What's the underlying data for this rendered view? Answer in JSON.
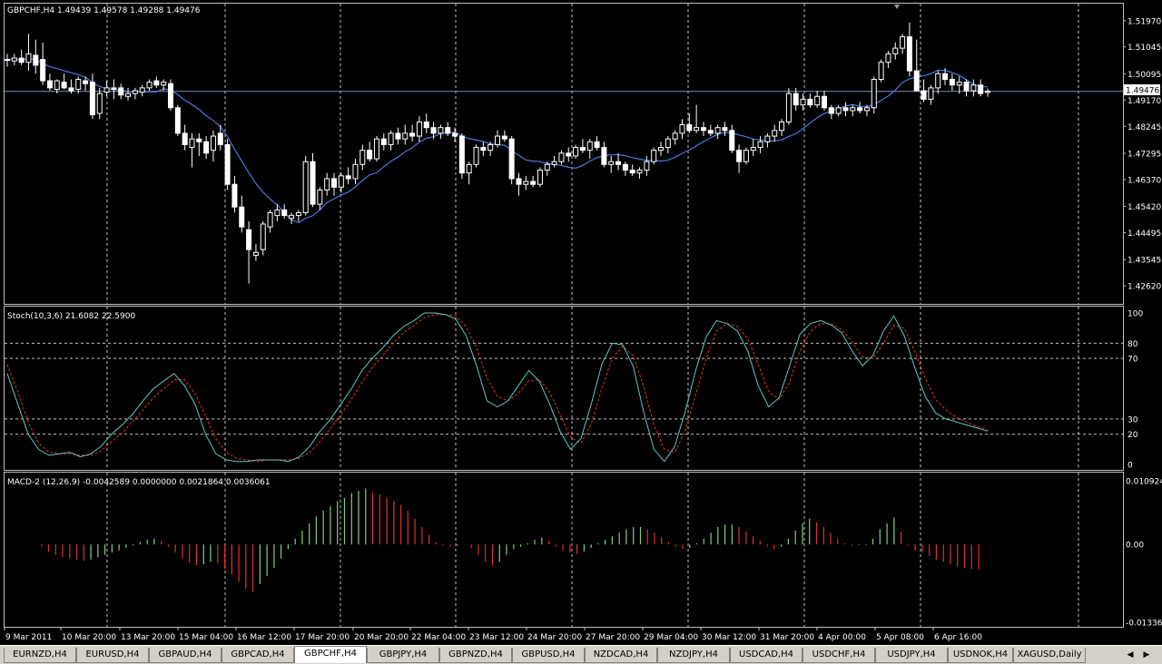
{
  "main_chart": {
    "header": "GBPCHF,H4  1.49439 1.49578 1.49288 1.49476",
    "price_min": 1.4205,
    "price_max": 1.5225,
    "price_labels": [
      "1.51970",
      "1.51045",
      "1.50095",
      "1.49170",
      "1.48245",
      "1.47295",
      "1.46370",
      "1.45420",
      "1.44495",
      "1.43545",
      "1.42620"
    ],
    "current_price_label": "1.49476",
    "current_price": 1.49476,
    "colors": {
      "bull": "#ffffff",
      "bear": "#ffffff",
      "ma": "#4a78e0",
      "current_line": "#7a8fbf",
      "grid": "#c0c0c0",
      "axis_text": "#ffffff"
    }
  },
  "stoch": {
    "header": "Stoch(10,3,6) 21.6082 22.5900",
    "labels": [
      "100",
      "80",
      "70",
      "30",
      "20",
      "0"
    ],
    "level_values": [
      80,
      70,
      30,
      20
    ],
    "main_color": "#5fc9c0",
    "signal_color": "#e03030",
    "main": [
      60,
      40,
      20,
      10,
      6,
      7,
      8,
      5,
      7,
      12,
      20,
      26,
      33,
      42,
      50,
      55,
      60,
      52,
      40,
      20,
      7,
      3,
      2,
      2,
      3,
      3,
      3,
      2,
      5,
      12,
      22,
      30,
      40,
      50,
      62,
      70,
      77,
      85,
      91,
      95,
      100,
      100,
      99,
      96,
      85,
      65,
      42,
      38,
      42,
      52,
      62,
      55,
      40,
      22,
      10,
      17,
      40,
      66,
      80,
      79,
      65,
      35,
      10,
      2,
      12,
      35,
      62,
      84,
      95,
      93,
      88,
      75,
      52,
      38,
      44,
      65,
      86,
      93,
      95,
      92,
      87,
      75,
      65,
      72,
      88,
      98,
      85,
      64,
      45,
      34,
      30,
      28,
      26,
      24,
      22
    ],
    "signal": [
      66,
      48,
      28,
      14,
      8,
      7,
      7,
      6,
      6,
      9,
      15,
      21,
      28,
      36,
      44,
      50,
      56,
      56,
      47,
      32,
      17,
      8,
      4,
      3,
      2,
      3,
      3,
      3,
      4,
      8,
      15,
      24,
      33,
      43,
      54,
      64,
      72,
      80,
      87,
      92,
      97,
      99,
      99,
      98,
      91,
      77,
      57,
      45,
      42,
      47,
      55,
      56,
      48,
      33,
      18,
      14,
      27,
      50,
      70,
      78,
      72,
      52,
      26,
      10,
      8,
      22,
      46,
      70,
      88,
      93,
      91,
      83,
      66,
      48,
      43,
      54,
      75,
      88,
      93,
      93,
      89,
      81,
      71,
      70,
      80,
      92,
      90,
      75,
      57,
      43,
      36,
      31,
      28,
      25,
      23
    ]
  },
  "macd": {
    "header": "MACD-2 (12,26,9) -0.0042589 0.0000000 0.0021864 0.0036061",
    "top_label": "0.010924",
    "zero_label": "0.00",
    "bottom_label": "-0.01336",
    "top_value": 0.010924,
    "bottom_value": -0.01336,
    "up_color": "#80d080",
    "down_color": "#e03030"
  },
  "x_labels": [
    "9 Mar 2011",
    "10 Mar 20:00",
    "13 Mar 20:00",
    "15 Mar 04:00",
    "16 Mar 12:00",
    "17 Mar 20:00",
    "20 Mar 20:00",
    "22 Mar 04:00",
    "23 Mar 12:00",
    "24 Mar 20:00",
    "27 Mar 20:00",
    "29 Mar 04:00",
    "30 Mar 12:00",
    "31 Mar 20:00",
    "4 Apr 00:00",
    "5 Apr 08:00",
    "6 Apr 16:00"
  ],
  "candles": [
    [
      1.506,
      1.508,
      1.5035,
      1.506
    ],
    [
      1.5055,
      1.508,
      1.504,
      1.5065
    ],
    [
      1.5065,
      1.5095,
      1.504,
      1.505
    ],
    [
      1.505,
      1.515,
      1.502,
      1.508
    ],
    [
      1.5075,
      1.513,
      1.501,
      1.504
    ],
    [
      1.506,
      1.512,
      1.497,
      1.4985
    ],
    [
      1.4985,
      1.501,
      1.495,
      1.496
    ],
    [
      1.4955,
      1.499,
      1.494,
      1.4985
    ],
    [
      1.498,
      1.501,
      1.4955,
      1.496
    ],
    [
      1.496,
      1.499,
      1.494,
      1.495
    ],
    [
      1.4955,
      1.5,
      1.494,
      1.499
    ],
    [
      1.4985,
      1.5,
      1.495,
      1.4975
    ],
    [
      1.498,
      1.501,
      1.485,
      1.4865
    ],
    [
      1.487,
      1.496,
      1.485,
      1.494
    ],
    [
      1.4945,
      1.4985,
      1.493,
      1.496
    ],
    [
      1.496,
      1.499,
      1.492,
      1.4955
    ],
    [
      1.496,
      1.4975,
      1.492,
      1.4935
    ],
    [
      1.493,
      1.496,
      1.4915,
      1.494
    ],
    [
      1.494,
      1.496,
      1.492,
      1.495
    ],
    [
      1.4945,
      1.497,
      1.493,
      1.496
    ],
    [
      1.496,
      1.499,
      1.495,
      1.498
    ],
    [
      1.4985,
      1.5,
      1.496,
      1.497
    ],
    [
      1.497,
      1.499,
      1.495,
      1.498
    ],
    [
      1.4975,
      1.499,
      1.488,
      1.489
    ],
    [
      1.489,
      1.49,
      1.479,
      1.48
    ],
    [
      1.48,
      1.483,
      1.474,
      1.476
    ],
    [
      1.475,
      1.48,
      1.468,
      1.478
    ],
    [
      1.478,
      1.48,
      1.472,
      1.477
    ],
    [
      1.477,
      1.479,
      1.471,
      1.473
    ],
    [
      1.474,
      1.481,
      1.47,
      1.479
    ],
    [
      1.48,
      1.483,
      1.474,
      1.476
    ],
    [
      1.476,
      1.478,
      1.46,
      1.462
    ],
    [
      1.462,
      1.465,
      1.452,
      1.454
    ],
    [
      1.454,
      1.458,
      1.445,
      1.447
    ],
    [
      1.446,
      1.449,
      1.427,
      1.439
    ],
    [
      1.437,
      1.441,
      1.435,
      1.438
    ],
    [
      1.439,
      1.449,
      1.437,
      1.448
    ],
    [
      1.447,
      1.453,
      1.445,
      1.452
    ],
    [
      1.451,
      1.455,
      1.449,
      1.453
    ],
    [
      1.453,
      1.455,
      1.45,
      1.451
    ],
    [
      1.45,
      1.452,
      1.448,
      1.451
    ],
    [
      1.451,
      1.453,
      1.449,
      1.452
    ],
    [
      1.452,
      1.472,
      1.451,
      1.47
    ],
    [
      1.47,
      1.473,
      1.454,
      1.455
    ],
    [
      1.455,
      1.461,
      1.453,
      1.46
    ],
    [
      1.46,
      1.466,
      1.458,
      1.464
    ],
    [
      1.464,
      1.466,
      1.458,
      1.461
    ],
    [
      1.461,
      1.466,
      1.459,
      1.465
    ],
    [
      1.465,
      1.468,
      1.462,
      1.464
    ],
    [
      1.464,
      1.471,
      1.462,
      1.469
    ],
    [
      1.469,
      1.476,
      1.467,
      1.474
    ],
    [
      1.474,
      1.477,
      1.47,
      1.471
    ],
    [
      1.471,
      1.479,
      1.47,
      1.478
    ],
    [
      1.478,
      1.48,
      1.474,
      1.476
    ],
    [
      1.476,
      1.481,
      1.474,
      1.48
    ],
    [
      1.48,
      1.482,
      1.476,
      1.478
    ],
    [
      1.478,
      1.483,
      1.476,
      1.48
    ],
    [
      1.48,
      1.483,
      1.477,
      1.479
    ],
    [
      1.479,
      1.486,
      1.477,
      1.484
    ],
    [
      1.484,
      1.487,
      1.48,
      1.482
    ],
    [
      1.482,
      1.484,
      1.478,
      1.48
    ],
    [
      1.48,
      1.483,
      1.478,
      1.482
    ],
    [
      1.482,
      1.484,
      1.479,
      1.48
    ],
    [
      1.48,
      1.482,
      1.477,
      1.479
    ],
    [
      1.479,
      1.48,
      1.464,
      1.466
    ],
    [
      1.466,
      1.47,
      1.462,
      1.469
    ],
    [
      1.469,
      1.476,
      1.468,
      1.475
    ],
    [
      1.475,
      1.477,
      1.472,
      1.474
    ],
    [
      1.474,
      1.477,
      1.472,
      1.476
    ],
    [
      1.476,
      1.481,
      1.475,
      1.479
    ],
    [
      1.479,
      1.481,
      1.477,
      1.478
    ],
    [
      1.478,
      1.479,
      1.462,
      1.464
    ],
    [
      1.464,
      1.466,
      1.458,
      1.462
    ],
    [
      1.462,
      1.465,
      1.46,
      1.463
    ],
    [
      1.463,
      1.465,
      1.461,
      1.462
    ],
    [
      1.462,
      1.468,
      1.461,
      1.467
    ],
    [
      1.467,
      1.47,
      1.465,
      1.469
    ],
    [
      1.469,
      1.472,
      1.468,
      1.47
    ],
    [
      1.47,
      1.474,
      1.469,
      1.473
    ],
    [
      1.473,
      1.475,
      1.47,
      1.472
    ],
    [
      1.472,
      1.476,
      1.471,
      1.475
    ],
    [
      1.475,
      1.478,
      1.473,
      1.474
    ],
    [
      1.474,
      1.478,
      1.471,
      1.477
    ],
    [
      1.477,
      1.479,
      1.474,
      1.475
    ],
    [
      1.475,
      1.477,
      1.468,
      1.469
    ],
    [
      1.469,
      1.472,
      1.466,
      1.47
    ],
    [
      1.47,
      1.473,
      1.467,
      1.469
    ],
    [
      1.469,
      1.47,
      1.465,
      1.467
    ],
    [
      1.467,
      1.469,
      1.465,
      1.466
    ],
    [
      1.466,
      1.468,
      1.464,
      1.467
    ],
    [
      1.467,
      1.472,
      1.465,
      1.47
    ],
    [
      1.47,
      1.475,
      1.469,
      1.474
    ],
    [
      1.474,
      1.477,
      1.472,
      1.475
    ],
    [
      1.475,
      1.479,
      1.473,
      1.478
    ],
    [
      1.478,
      1.481,
      1.476,
      1.48
    ],
    [
      1.48,
      1.485,
      1.478,
      1.483
    ],
    [
      1.483,
      1.487,
      1.48,
      1.481
    ],
    [
      1.481,
      1.49,
      1.48,
      1.482
    ],
    [
      1.482,
      1.484,
      1.479,
      1.481
    ],
    [
      1.481,
      1.483,
      1.479,
      1.48
    ],
    [
      1.48,
      1.483,
      1.478,
      1.482
    ],
    [
      1.482,
      1.484,
      1.479,
      1.481
    ],
    [
      1.481,
      1.483,
      1.473,
      1.474
    ],
    [
      1.474,
      1.476,
      1.466,
      1.47
    ],
    [
      1.47,
      1.475,
      1.469,
      1.474
    ],
    [
      1.474,
      1.478,
      1.472,
      1.475
    ],
    [
      1.475,
      1.479,
      1.473,
      1.477
    ],
    [
      1.477,
      1.48,
      1.475,
      1.479
    ],
    [
      1.479,
      1.483,
      1.477,
      1.481
    ],
    [
      1.481,
      1.485,
      1.479,
      1.484
    ],
    [
      1.484,
      1.496,
      1.483,
      1.494
    ],
    [
      1.494,
      1.496,
      1.488,
      1.49
    ],
    [
      1.49,
      1.494,
      1.488,
      1.492
    ],
    [
      1.492,
      1.494,
      1.489,
      1.49
    ],
    [
      1.49,
      1.495,
      1.489,
      1.493
    ],
    [
      1.493,
      1.495,
      1.488,
      1.489
    ],
    [
      1.489,
      1.49,
      1.485,
      1.487
    ],
    [
      1.487,
      1.49,
      1.486,
      1.489
    ],
    [
      1.489,
      1.491,
      1.486,
      1.488
    ],
    [
      1.488,
      1.49,
      1.486,
      1.489
    ],
    [
      1.489,
      1.491,
      1.487,
      1.488
    ],
    [
      1.488,
      1.49,
      1.486,
      1.489
    ],
    [
      1.489,
      1.5,
      1.487,
      1.499
    ],
    [
      1.499,
      1.506,
      1.498,
      1.505
    ],
    [
      1.505,
      1.509,
      1.503,
      1.508
    ],
    [
      1.508,
      1.512,
      1.506,
      1.51
    ],
    [
      1.51,
      1.515,
      1.508,
      1.514
    ],
    [
      1.514,
      1.519,
      1.5,
      1.502
    ],
    [
      1.502,
      1.513,
      1.498,
      1.495
    ],
    [
      1.495,
      1.499,
      1.491,
      1.492
    ],
    [
      1.492,
      1.497,
      1.49,
      1.496
    ],
    [
      1.496,
      1.502,
      1.494,
      1.501
    ],
    [
      1.501,
      1.503,
      1.497,
      1.499
    ],
    [
      1.499,
      1.501,
      1.495,
      1.497
    ],
    [
      1.497,
      1.5,
      1.494,
      1.498
    ],
    [
      1.498,
      1.499,
      1.493,
      1.495
    ],
    [
      1.495,
      1.499,
      1.493,
      1.497
    ],
    [
      1.497,
      1.499,
      1.493,
      1.494
    ],
    [
      1.4944,
      1.4958,
      1.4929,
      1.4948
    ]
  ],
  "macd_hist": [
    0.0,
    -0.0004,
    -0.0012,
    -0.0018,
    -0.0022,
    -0.0024,
    -0.0026,
    -0.0028,
    -0.0026,
    -0.0022,
    -0.0018,
    -0.0014,
    -0.001,
    -0.0006,
    -0.0002,
    0.0004,
    0.0008,
    0.001,
    0.0006,
    -0.0004,
    -0.0014,
    -0.0024,
    -0.0032,
    -0.0036,
    -0.0034,
    -0.003,
    -0.0032,
    -0.0042,
    -0.0052,
    -0.0064,
    -0.0076,
    -0.0082,
    -0.0068,
    -0.0054,
    -0.004,
    -0.0024,
    -0.0008,
    0.001,
    0.0024,
    0.0036,
    0.0048,
    0.0058,
    0.0066,
    0.0074,
    0.008,
    0.0088,
    0.0092,
    0.0096,
    0.009,
    0.0086,
    0.008,
    0.0074,
    0.0068,
    0.0058,
    0.0044,
    0.003,
    0.0016,
    0.0004,
    -0.0002,
    -0.0004,
    -0.0002,
    0.0,
    -0.0006,
    -0.0018,
    -0.003,
    -0.0036,
    -0.003,
    -0.0018,
    -0.0008,
    -0.0004,
    0.0002,
    0.0008,
    0.0012,
    0.0006,
    -0.0004,
    -0.001,
    -0.0014,
    -0.0016,
    -0.0012,
    -0.0006,
    0.0002,
    0.0008,
    0.0014,
    0.002,
    0.0026,
    0.003,
    0.003,
    0.0026,
    0.002,
    0.0012,
    0.0004,
    -0.0004,
    -0.0008,
    -0.0006,
    0.0002,
    0.001,
    0.002,
    0.003,
    0.0034,
    0.0034,
    0.003,
    0.0022,
    0.0014,
    0.0006,
    -0.0004,
    -0.0008,
    -0.0004,
    0.001,
    0.0024,
    0.0036,
    0.0044,
    0.0038,
    0.003,
    0.002,
    0.001,
    0.0002,
    -0.0002,
    -0.0001,
    -0.0001,
    0.001,
    0.0026,
    0.0036,
    0.0046,
    0.0022,
    -0.0002,
    -0.001,
    -0.0014,
    -0.002,
    -0.0026,
    -0.003,
    -0.0034,
    -0.0038,
    -0.004,
    -0.0042,
    -0.0043
  ],
  "tabs": [
    {
      "label": "EURNZD,H4"
    },
    {
      "label": "EURUSD,H4"
    },
    {
      "label": "GBPAUD,H4"
    },
    {
      "label": "GBPCAD,H4"
    },
    {
      "label": "GBPCHF,H4",
      "active": true
    },
    {
      "label": "GBPJPY,H4"
    },
    {
      "label": "GBPNZD,H4"
    },
    {
      "label": "GBPUSD,H4"
    },
    {
      "label": "NZDCAD,H4"
    },
    {
      "label": "NZDJPY,H4"
    },
    {
      "label": "USDCAD,H4"
    },
    {
      "label": "USDCHF,H4"
    },
    {
      "label": "USDJPY,H4"
    },
    {
      "label": "USDNOK,H4"
    },
    {
      "label": "XAGUSD,Daily"
    }
  ],
  "nav_icons": {
    "left": "triangle-left-icon",
    "right": "triangle-right-icon"
  }
}
